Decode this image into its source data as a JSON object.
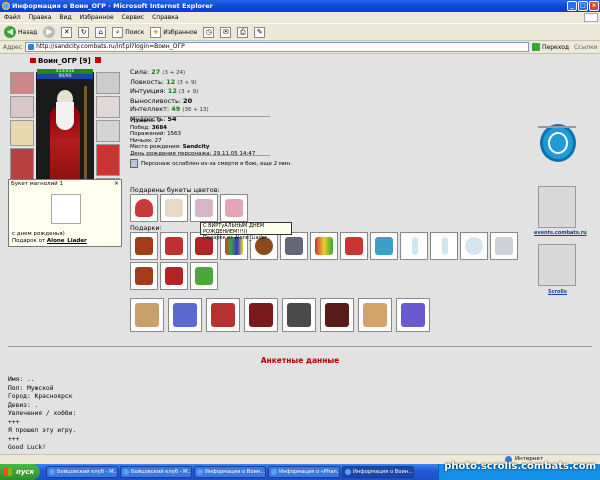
{
  "window": {
    "title": "Информация о Воин_ОГР - Microsoft Internet Explorer"
  },
  "menu": [
    "Файл",
    "Правка",
    "Вид",
    "Избранное",
    "Сервис",
    "Справка"
  ],
  "toolbar": {
    "back": "Назад",
    "search": "Поиск",
    "favorites": "Избранное"
  },
  "address": {
    "label": "Адрес",
    "url": "http://sandcity.combats.ru/inf.pl?login=Воин_ОГР",
    "go": "Переход",
    "links": "Ссылки"
  },
  "character": {
    "name": "Воин_ОГР",
    "level": "[9]",
    "hp": "454/456",
    "mp": "90/90"
  },
  "stats": [
    {
      "label": "Сила:",
      "value": "27",
      "bonus": "(3 + 24)",
      "green": true
    },
    {
      "label": "Ловкость:",
      "value": "12",
      "bonus": "(3 + 9)",
      "green": true
    },
    {
      "label": "Интуиция:",
      "value": "12",
      "bonus": "(3 + 9)",
      "green": true
    },
    {
      "label": "Выносливость:",
      "value": "20",
      "bonus": "",
      "green": false
    },
    {
      "label": "Интеллект:",
      "value": "49",
      "bonus": "(36 + 13)",
      "green": true
    },
    {
      "label": "Мудрость:",
      "value": "54",
      "bonus": "",
      "green": false
    }
  ],
  "info": [
    {
      "label": "Уровень:",
      "value": "9"
    },
    {
      "label": "Побед:",
      "value": "3684"
    },
    {
      "label": "Поражений:",
      "value": "1563"
    },
    {
      "label": "Ничьих:",
      "value": "27"
    },
    {
      "label": "Место рождения:",
      "value": "Sandcity"
    },
    {
      "label": "День рождения персонажа:",
      "value": "29.11.05 14:47"
    }
  ],
  "weakness": "Персонаж ослаблен из-за смерти в бою, еще 2 мин.",
  "flowers_title": "Подарены букеты цветов:",
  "gifts_title": "Подарки:",
  "tooltip": {
    "title": "Букет магнолий 1",
    "line1": "с днем рожденья)",
    "from_label": "Подарок от",
    "from_name": "Alone_Liader"
  },
  "hint": {
    "line1": "С ВИРТуАЛЬНЫМ ДНЕМ РОЖДЕНИЕМ!!!))",
    "line2": "Подарок от Alone_Liader"
  },
  "sidebar": {
    "events": "events.combats.ru",
    "scrolls": "Scrolls"
  },
  "anket_title": "Анкетные данные",
  "profile": {
    "name": "Имя: ..",
    "gender": "Пол: Мужской",
    "city": "Город: Красноярск",
    "motto": "Девиз: .",
    "hobby": "Увлечения / хобби:",
    "l1": "+++",
    "l2": "Я прошел эту игру.",
    "l3": "+++",
    "l4": "Good Luck!"
  },
  "status": {
    "zone": "Интернет"
  },
  "taskbar": {
    "start": "пуск",
    "tasks": [
      "Бойцовский клуб - M...",
      "Бойцовский клуб - M...",
      "Информация о Воин...",
      "Информация о «Phan...",
      "Информация о Воин..."
    ]
  },
  "watermark": "photo.scrolls.combats.com"
}
